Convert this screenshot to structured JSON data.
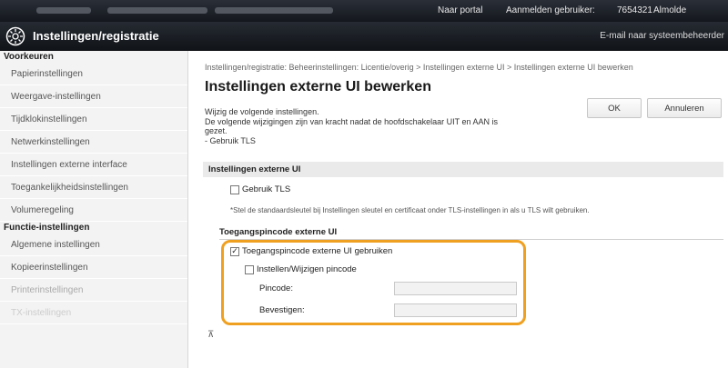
{
  "topbar": {
    "portal_link": "Naar portal",
    "login_label": "Aanmelden gebruiker:",
    "user_id": "7654321",
    "user_name": "Almolde"
  },
  "header": {
    "app_title": "Instellingen/registratie",
    "mail_link": "E-mail naar systeembeheerder"
  },
  "sidebar": {
    "section1": "Voorkeuren",
    "items1": [
      "Papierinstellingen",
      "Weergave-instellingen",
      "Tijdklokinstellingen",
      "Netwerkinstellingen",
      "Instellingen externe interface",
      "Toegankelijkheidsinstellingen",
      "Volumeregeling"
    ],
    "section2": "Functie-instellingen",
    "items2": [
      "Algemene instellingen",
      "Kopieerinstellingen",
      "Printerinstellingen",
      "TX-instellingen"
    ]
  },
  "main": {
    "breadcrumb": "Instellingen/registratie: Beheerinstellingen: Licentie/overig > Instellingen externe UI > Instellingen externe UI bewerken",
    "title": "Instellingen externe UI bewerken",
    "desc_line1": "Wijzig de volgende instellingen.",
    "desc_line2": "De volgende wijzigingen zijn van kracht nadat de hoofdschakelaar UIT en AAN is",
    "desc_line3": "gezet.",
    "desc_line4": "- Gebruik TLS",
    "ok_label": "OK",
    "cancel_label": "Annuleren",
    "section_title": "Instellingen externe UI",
    "use_tls_label": "Gebruik TLS",
    "use_tls_checked": false,
    "tls_note": "*Stel de standaardsleutel bij Instellingen sleutel en certificaat onder TLS-instellingen in als u TLS wilt gebruiken.",
    "pin_section_title": "Toegangspincode externe UI",
    "use_pin_label": "Toegangspincode externe UI gebruiken",
    "use_pin_checked": true,
    "set_pin_label": "Instellen/Wijzigen pincode",
    "set_pin_checked": false,
    "pin_label": "Pincode:",
    "confirm_label": "Bevestigen:",
    "pin_value": "",
    "confirm_value": "",
    "scroll_top_glyph": "⊼"
  },
  "colors": {
    "highlight": "#f0a020",
    "titlebar": "#14171c"
  }
}
